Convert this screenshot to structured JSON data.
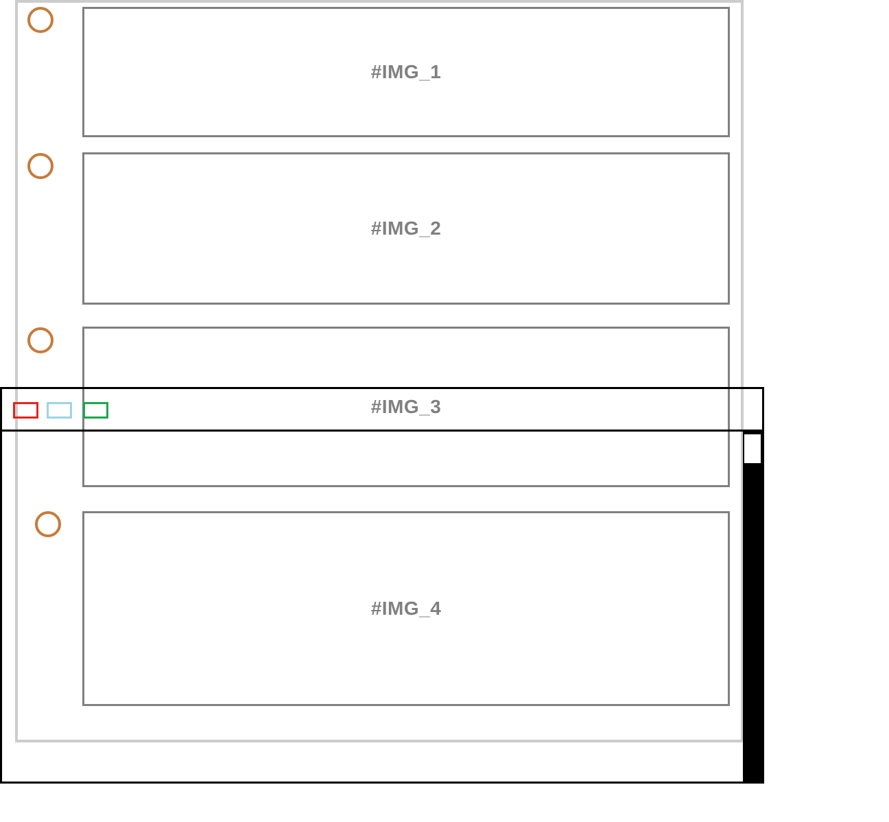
{
  "list": {
    "items": [
      {
        "label": "#IMG_1"
      },
      {
        "label": "#IMG_2"
      },
      {
        "label": "#IMG_3"
      },
      {
        "label": "#IMG_4"
      }
    ]
  },
  "colors": {
    "bullet_border": "#c77b3a",
    "slot_border": "#808080",
    "frame_border": "#cccccc",
    "window_border": "#000000",
    "traffic_red": "#e1261c",
    "traffic_blue": "#9fd3e6",
    "traffic_green": "#1aa84f"
  }
}
